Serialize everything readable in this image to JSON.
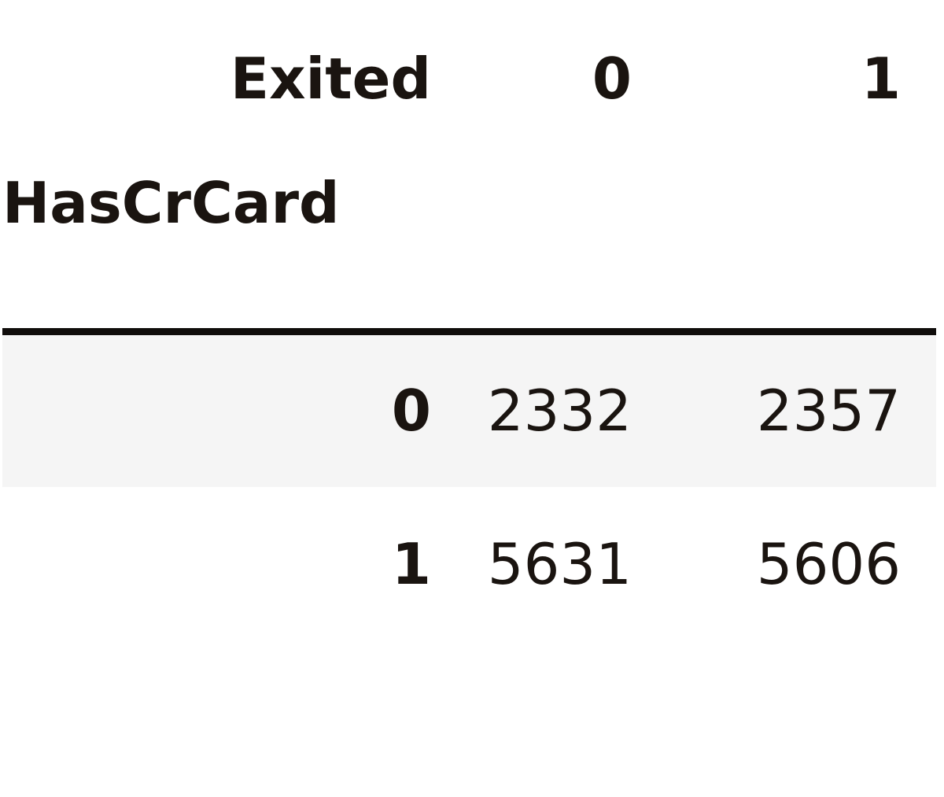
{
  "table": {
    "columns_name": "Exited",
    "index_name": "HasCrCard",
    "column_headers": [
      "0",
      "1"
    ],
    "rows": [
      {
        "index": "0",
        "values": [
          "2332",
          "2357"
        ]
      },
      {
        "index": "1",
        "values": [
          "5631",
          "5606"
        ]
      }
    ],
    "styling": {
      "text_color": "#1a1410",
      "rule_color": "#100d0b",
      "stripe_color": "#f5f5f5",
      "page_background": "#ffffff"
    }
  },
  "chart_data": {
    "type": "table",
    "title": "",
    "xlabel": "Exited",
    "ylabel": "HasCrCard",
    "categories": [
      "0",
      "1"
    ],
    "index": [
      "0",
      "1"
    ],
    "series": [
      {
        "name": "0",
        "values": [
          2332,
          5631
        ]
      },
      {
        "name": "1",
        "values": [
          2357,
          5606
        ]
      }
    ],
    "cells": [
      [
        2332,
        2357
      ],
      [
        5631,
        5606
      ]
    ],
    "grid": false,
    "legend": "none"
  }
}
